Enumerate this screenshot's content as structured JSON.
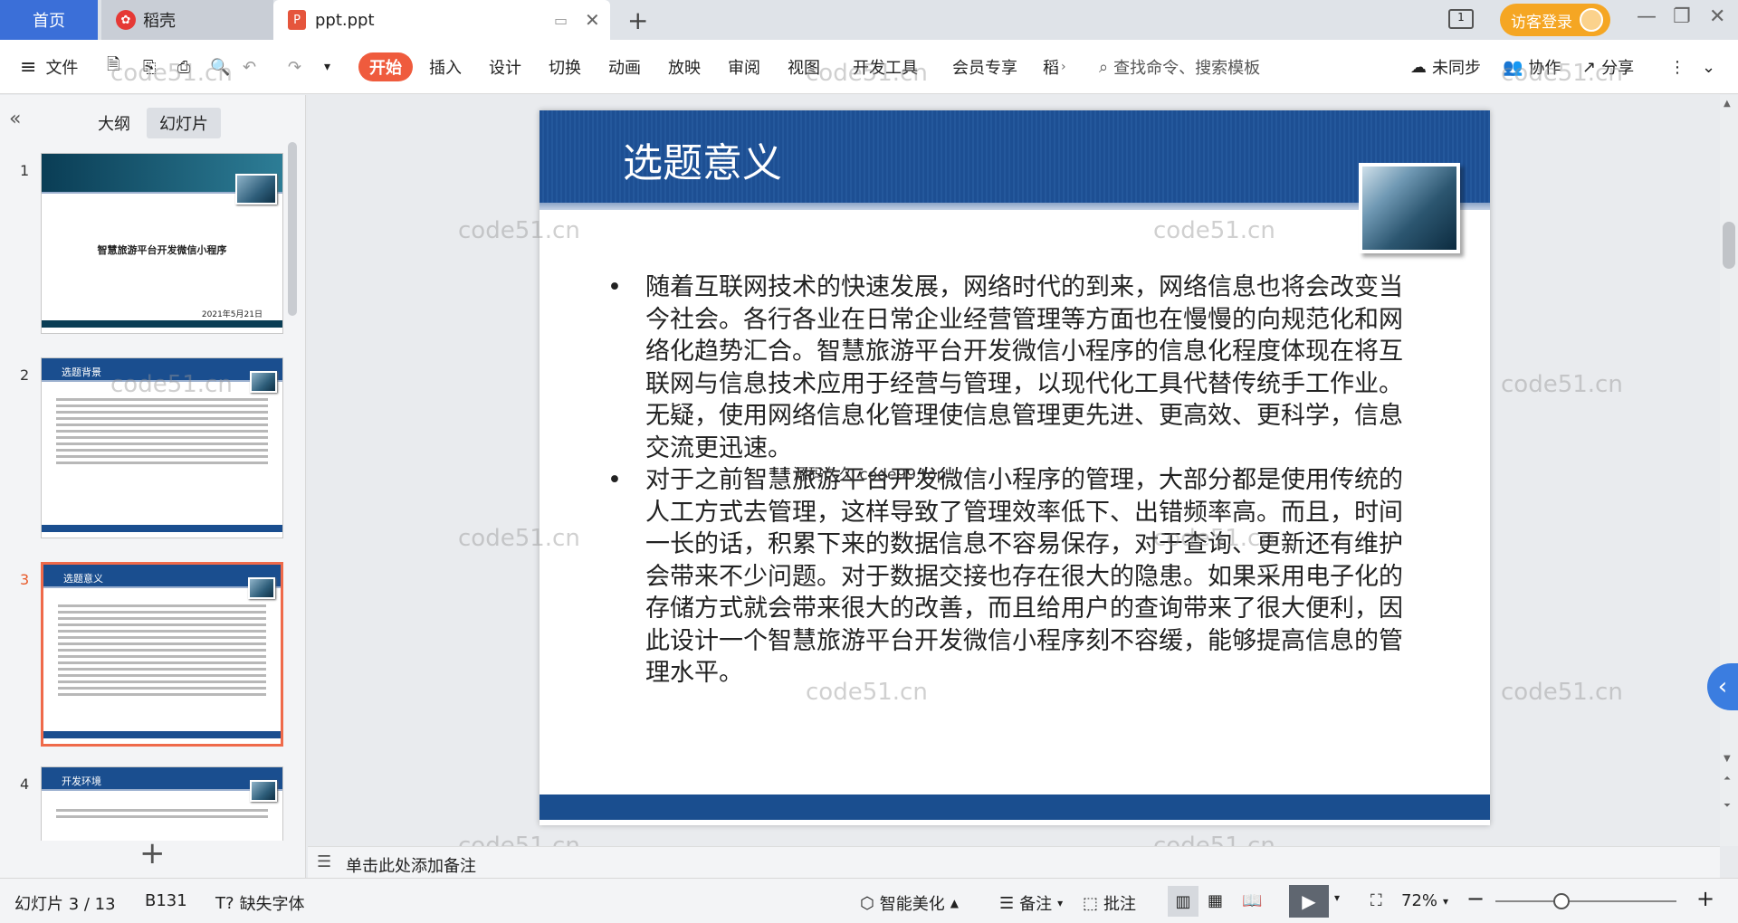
{
  "tabs": {
    "home": "首页",
    "daoke": "稻壳",
    "file": "ppt.ppt",
    "login": "访客登录"
  },
  "toolbar": {
    "file_menu": "文件",
    "ribbon_tabs": [
      "开始",
      "插入",
      "设计",
      "切换",
      "动画",
      "放映",
      "审阅",
      "视图",
      "开发工具",
      "会员专享",
      "稻"
    ],
    "search_placeholder": "查找命令、搜索模板",
    "unsynced": "未同步",
    "collab": "协作",
    "share": "分享"
  },
  "left_panel": {
    "tab_outline": "大纲",
    "tab_slides": "幻灯片",
    "thumbs": [
      {
        "num": "1",
        "title": "智慧旅游平台开发微信小程序",
        "date": "2021年5月21日"
      },
      {
        "num": "2",
        "title": "选题背景"
      },
      {
        "num": "3",
        "title": "选题意义"
      },
      {
        "num": "4",
        "title": "开发环境"
      }
    ],
    "add": "+"
  },
  "slide": {
    "title": "选题意义",
    "bullets": [
      "随着互联网技术的快速发展，网络时代的到来，网络信息也将会改变当今社会。各行各业在日常企业经营管理等方面也在慢慢的向规范化和网络化趋势汇合。智慧旅游平台开发微信小程序的信息化程度体现在将互联网与信息技术应用于经营与管理，以现代化工具代替传统手工作业。无疑，使用网络信息化管理使信息管理更先进、更高效、更科学，信息交流更迅速。",
      "对于之前智慧旅游平台开发微信小程序的管理，大部分都是使用传统的人工方式去管理，这样导致了管理效率低下、出错频率高。而且，时间一长的话，积累下来的数据信息不容易保存，对于查询、更新还有维护会带来不少问题。对于数据交接也存在很大的隐患。如果采用电子化的存储方式就会带来很大的改善，而且给用户的查询带来了很大便利，因此设计一个智慧旅游平台开发微信小程序刻不容缓，能够提高信息的管理水平。"
    ],
    "overlay_text": "源码久久 code99.top"
  },
  "watermark": "code51.cn",
  "notes": "单击此处添加备注",
  "status": {
    "slide_count": "幻灯片 3 / 13",
    "cell": "B131",
    "missing_font": "缺失字体",
    "beautify": "智能美化",
    "notes": "备注",
    "comments": "批注",
    "zoom": "72%"
  },
  "colors": {
    "accent": "#ef5b3d",
    "slide_blue": "#1a4e8f",
    "home_tab": "#3b6fd8",
    "login_orange": "#f5a623"
  }
}
